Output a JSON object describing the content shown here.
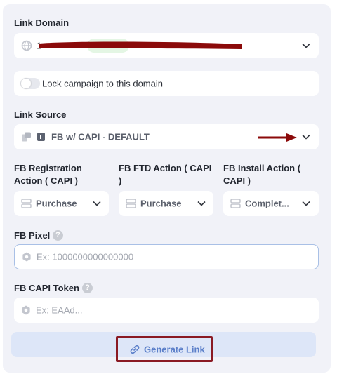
{
  "link_domain": {
    "label": "Link Domain",
    "value": "1"
  },
  "lock_campaign": {
    "label": "Lock campaign to this domain"
  },
  "link_source": {
    "label": "Link Source",
    "value": "FB w/ CAPI - DEFAULT"
  },
  "actions": [
    {
      "label": "FB Registration Action ( CAPI )",
      "line1": "FB Registration",
      "line2": "Action ( CAPI )",
      "value": "Purchase"
    },
    {
      "label": "FB FTD Action ( CAPI )",
      "line1": "FB FTD Action ( CAPI",
      "line2": ")",
      "value": "Purchase"
    },
    {
      "label": "FB Install Action ( CAPI )",
      "line1": "FB Install Action (",
      "line2": "CAPI )",
      "value": "Complet..."
    }
  ],
  "fb_pixel": {
    "label": "FB Pixel",
    "help": "?",
    "placeholder": "Ex: 1000000000000000"
  },
  "fb_capi_token": {
    "label": "FB CAPI Token",
    "help": "?",
    "placeholder": "Ex: EAAd..."
  },
  "generate": {
    "label": "Generate Link"
  },
  "colors": {
    "card_bg": "#f1f2f8",
    "accent": "#5b7fc9",
    "annotation_red": "#8a1a24"
  }
}
